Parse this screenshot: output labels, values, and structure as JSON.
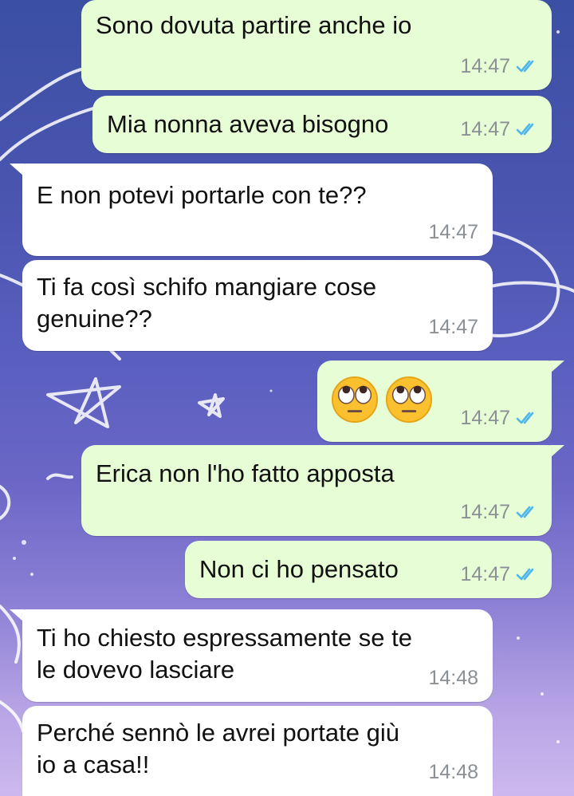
{
  "colors": {
    "outgoing_bubble": "#e7fdd6",
    "incoming_bubble": "#ffffff",
    "read_ticks": "#4fb6ec",
    "timestamp": "#8a9095"
  },
  "messages": [
    {
      "direction": "outgoing",
      "text": "Sono dovuta partire anche io",
      "time": "14:47",
      "status": "read-ticks-icon"
    },
    {
      "direction": "outgoing",
      "text": "Mia nonna aveva bisogno",
      "time": "14:47",
      "status": "read-ticks-icon"
    },
    {
      "direction": "incoming",
      "text": "E non potevi portarle con te??",
      "time": "14:47"
    },
    {
      "direction": "incoming",
      "text": "Ti fa così schifo mangiare cose\ngenuine??",
      "time": "14:47"
    },
    {
      "direction": "outgoing",
      "emoji": [
        "face-with-rolling-eyes-emoji",
        "face-with-rolling-eyes-emoji"
      ],
      "time": "14:47",
      "status": "read-ticks-icon"
    },
    {
      "direction": "outgoing",
      "text": "Erica non l'ho fatto apposta",
      "time": "14:47",
      "status": "read-ticks-icon"
    },
    {
      "direction": "outgoing",
      "text": "Non ci ho pensato",
      "time": "14:47",
      "status": "read-ticks-icon"
    },
    {
      "direction": "incoming",
      "text": "Ti ho chiesto espressamente se te\nle dovevo lasciare",
      "time": "14:48"
    },
    {
      "direction": "incoming",
      "text": "Perché sennò le avrei portate giù\nio a casa!!",
      "time": "14:48"
    }
  ]
}
